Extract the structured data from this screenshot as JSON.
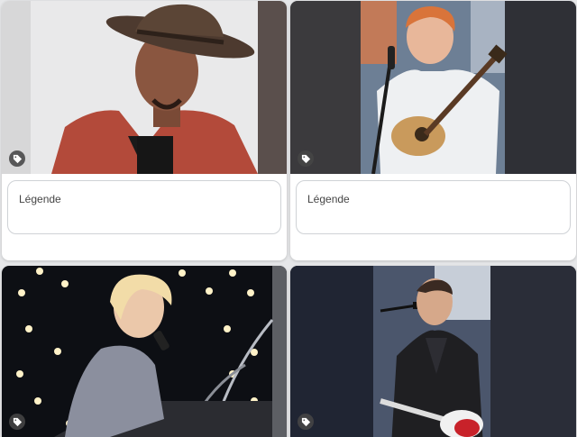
{
  "cards": [
    {
      "caption_placeholder": "Légende",
      "icon": "tag-icon"
    },
    {
      "caption_placeholder": "Légende",
      "icon": "tag-icon"
    },
    {
      "icon": "tag-icon"
    },
    {
      "icon": "tag-icon"
    }
  ]
}
